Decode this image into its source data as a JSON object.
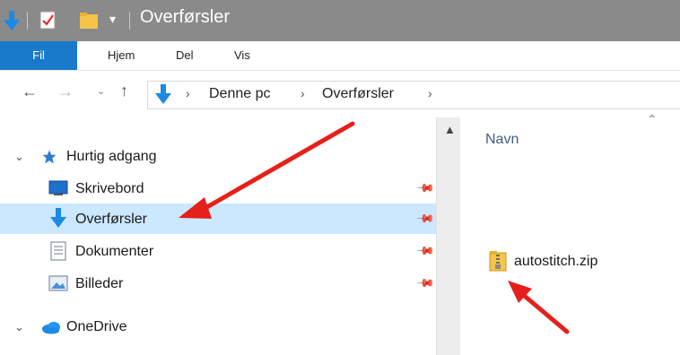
{
  "window": {
    "title": "Overførsler"
  },
  "ribbon": {
    "tabs": [
      "Fil",
      "Hjem",
      "Del",
      "Vis"
    ],
    "active_tab": "Fil",
    "accent": "#1979ca"
  },
  "address_bar": {
    "crumbs": [
      "Denne pc",
      "Overførsler"
    ]
  },
  "nav_pane": {
    "sections": [
      {
        "label": "Hurtig adgang",
        "icon": "star-icon"
      },
      {
        "label": "OneDrive",
        "icon": "cloud-icon"
      }
    ],
    "items": [
      {
        "label": "Skrivebord",
        "icon": "desktop-icon",
        "pinned": true,
        "selected": false
      },
      {
        "label": "Overførsler",
        "icon": "download-arrow-icon",
        "pinned": true,
        "selected": true
      },
      {
        "label": "Dokumenter",
        "icon": "document-icon",
        "pinned": true,
        "selected": false
      },
      {
        "label": "Billeder",
        "icon": "pictures-icon",
        "pinned": true,
        "selected": false
      }
    ],
    "selection_color": "#cce8ff"
  },
  "content": {
    "column_header": "Navn",
    "files": [
      {
        "name": "autostitch.zip",
        "icon": "zip-folder-icon"
      }
    ]
  },
  "annotations": {
    "arrow_color": "#e5201a"
  }
}
